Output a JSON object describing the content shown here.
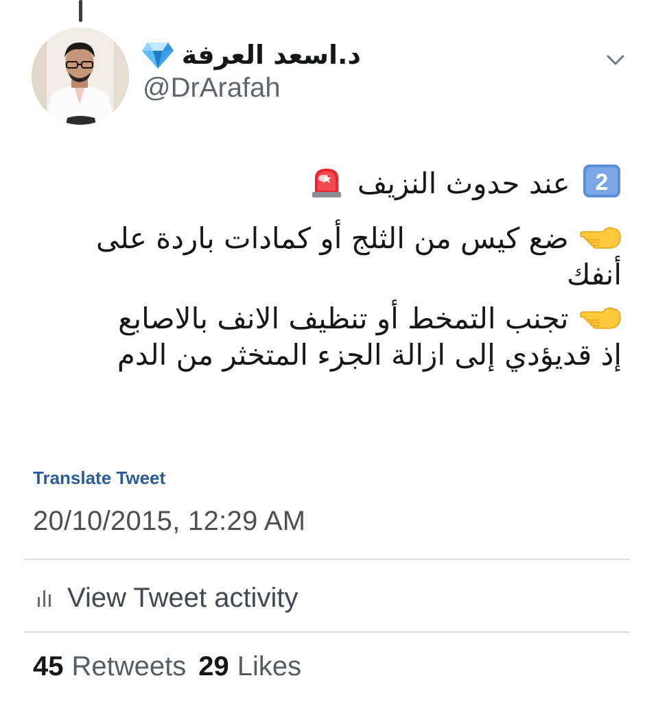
{
  "tweet": {
    "author": {
      "display_name": "د.اسعد العرفة",
      "handle": "@DrArafah",
      "badge_icon": "gem-stone-icon"
    },
    "menu_icon": "chevron-down-icon",
    "body": {
      "headline_emoji": "keycap-2-icon",
      "headline_number": "2",
      "headline_text": "عند حدوث النزيف",
      "headline_end_emoji": "police-siren-icon",
      "tip_emoji": "backhand-pointing-left-icon",
      "tip1_line1": "ضع كيس من الثلج أو كمادات باردة على",
      "tip1_line2": "أنفك",
      "tip2_line1": "تجنب التمخط أو تنظيف الانف بالاصابع",
      "tip2_line2": "إذ قديؤدي إلى ازالة الجزء المتخثر من الدم"
    },
    "translate_label": "Translate Tweet",
    "timestamp": "20/10/2015, 12:29 AM",
    "activity_label": "View Tweet activity",
    "retweets_count": "45",
    "retweets_label": "Retweets",
    "likes_count": "29",
    "likes_label": "Likes"
  },
  "colors": {
    "link": "#2b5c96",
    "text": "#14171a",
    "secondary": "#5b6770",
    "divider": "#d8dde1"
  }
}
